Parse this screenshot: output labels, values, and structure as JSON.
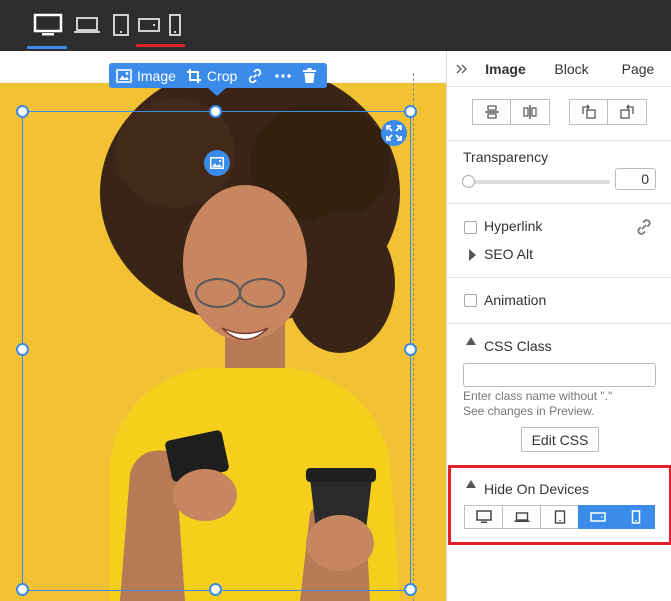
{
  "device_bar": {
    "devices": [
      {
        "name": "desktop",
        "active": true
      },
      {
        "name": "laptop",
        "active": false
      },
      {
        "name": "tablet",
        "active": false
      },
      {
        "name": "mobile-landscape",
        "active": false,
        "highlighted": true
      },
      {
        "name": "mobile-portrait",
        "active": false
      }
    ],
    "active_color": "#3b8beb",
    "highlight_color": "#e0202a"
  },
  "toolbar": {
    "image_label": "Image",
    "crop_label": "Crop"
  },
  "panel": {
    "tabs": [
      "Image",
      "Block",
      "Page"
    ],
    "active_tab": "Image",
    "transparency_label": "Transparency",
    "transparency_value": "0",
    "hyperlink_label": "Hyperlink",
    "seo_alt_label": "SEO Alt",
    "animation_label": "Animation",
    "css_class_label": "CSS Class",
    "css_hint_1": "Enter class name without \".\"",
    "css_hint_2": "See changes in Preview.",
    "edit_css_label": "Edit CSS",
    "hide_on_devices_label": "Hide On Devices",
    "hide_devices": [
      {
        "name": "desktop",
        "hidden": false
      },
      {
        "name": "laptop",
        "hidden": false
      },
      {
        "name": "tablet",
        "hidden": false
      },
      {
        "name": "mobile-landscape",
        "hidden": true
      },
      {
        "name": "mobile-portrait",
        "hidden": true
      }
    ]
  },
  "colors": {
    "accent": "#3b8beb",
    "photo_background": "#f3c234",
    "highlight_border": "#e0202a"
  }
}
